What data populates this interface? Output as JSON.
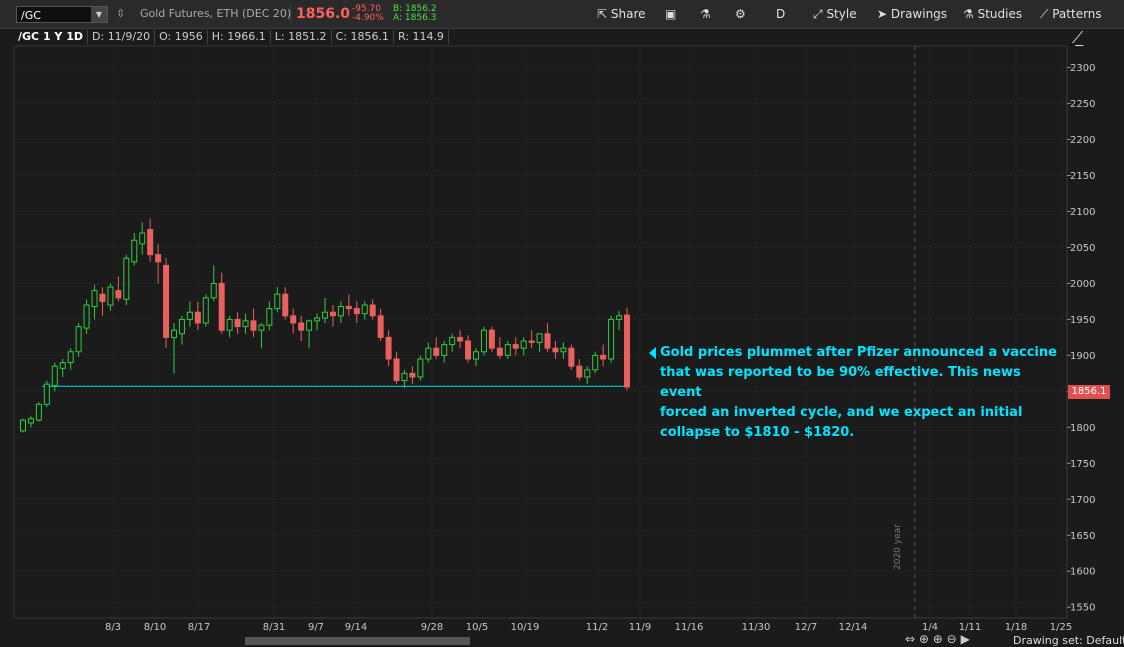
{
  "toolbar": {
    "symbol": "/GC",
    "description": "Gold Futures, ETH (DEC 20)",
    "last_price": "1856.0",
    "change": "-95.70",
    "change_pct": "-4.90%",
    "bid": "B: 1856.2",
    "ask": "A: 1856.3",
    "share_label": "Share",
    "aggregation": "D",
    "style_label": "Style",
    "drawings_label": "Drawings",
    "studies_label": "Studies",
    "patterns_label": "Patterns",
    "colors": {
      "down": "#e05050",
      "up": "#2ecc40",
      "accent": "#00e5ff"
    }
  },
  "infobar": {
    "symbol": "/GC 1 Y 1D",
    "date": "D: 11/9/20",
    "open": "O: 1956",
    "high": "H: 1966.1",
    "low": "L: 1851.2",
    "close": "C: 1856.1",
    "range": "R: 114.9"
  },
  "annotation": {
    "lines": [
      "Gold prices plummet after Pfizer announced a vaccine",
      "that was reported to be 90% effective. This news event",
      "forced an inverted cycle, and we expect an initial",
      "collapse to $1810 - $1820."
    ]
  },
  "price_tag": "1856.1",
  "year_label": "2020 year",
  "drawing_set": "Drawing set: Default",
  "chart_data": {
    "type": "candlestick",
    "y_ticks": [
      1550,
      1600,
      1650,
      1700,
      1750,
      1800,
      1850,
      1900,
      1950,
      2000,
      2050,
      2100,
      2150,
      2200,
      2250,
      2300
    ],
    "ylim": [
      1535,
      2330
    ],
    "x_ticks": [
      "8/3",
      "8/10",
      "8/17",
      "8/31",
      "9/7",
      "9/14",
      "9/28",
      "10/5",
      "10/19",
      "11/2",
      "11/9",
      "11/16",
      "11/30",
      "12/7",
      "12/14",
      "1/4",
      "1/11",
      "1/18",
      "1/25"
    ],
    "support_line": 1857,
    "candles": [
      [
        1795,
        1812,
        1793,
        1810
      ],
      [
        1806,
        1816,
        1800,
        1812
      ],
      [
        1810,
        1835,
        1808,
        1832
      ],
      [
        1832,
        1865,
        1828,
        1860
      ],
      [
        1858,
        1890,
        1850,
        1885
      ],
      [
        1882,
        1895,
        1870,
        1890
      ],
      [
        1890,
        1910,
        1880,
        1905
      ],
      [
        1905,
        1945,
        1898,
        1940
      ],
      [
        1938,
        1978,
        1930,
        1970
      ],
      [
        1968,
        1998,
        1950,
        1990
      ],
      [
        1985,
        1995,
        1955,
        1975
      ],
      [
        1970,
        2000,
        1962,
        1995
      ],
      [
        1990,
        2010,
        1975,
        1980
      ],
      [
        1978,
        2040,
        1970,
        2035
      ],
      [
        2030,
        2070,
        2025,
        2060
      ],
      [
        2055,
        2085,
        2040,
        2070
      ],
      [
        2075,
        2090,
        2030,
        2040
      ],
      [
        2040,
        2055,
        2000,
        2030
      ],
      [
        2025,
        2035,
        1910,
        1925
      ],
      [
        1925,
        1945,
        1875,
        1935
      ],
      [
        1930,
        1955,
        1915,
        1950
      ],
      [
        1950,
        1975,
        1940,
        1960
      ],
      [
        1960,
        1975,
        1935,
        1945
      ],
      [
        1945,
        1985,
        1940,
        1980
      ],
      [
        1980,
        2025,
        1975,
        2000
      ],
      [
        2000,
        2015,
        1930,
        1935
      ],
      [
        1935,
        1955,
        1925,
        1950
      ],
      [
        1950,
        1960,
        1930,
        1940
      ],
      [
        1940,
        1958,
        1930,
        1948
      ],
      [
        1948,
        1965,
        1925,
        1935
      ],
      [
        1935,
        1945,
        1910,
        1942
      ],
      [
        1942,
        1975,
        1935,
        1965
      ],
      [
        1965,
        1995,
        1960,
        1985
      ],
      [
        1985,
        1995,
        1950,
        1955
      ],
      [
        1955,
        1965,
        1930,
        1945
      ],
      [
        1945,
        1955,
        1920,
        1935
      ],
      [
        1935,
        1950,
        1910,
        1948
      ],
      [
        1948,
        1958,
        1935,
        1952
      ],
      [
        1952,
        1980,
        1945,
        1960
      ],
      [
        1960,
        1970,
        1940,
        1955
      ],
      [
        1955,
        1975,
        1945,
        1968
      ],
      [
        1968,
        1985,
        1955,
        1965
      ],
      [
        1965,
        1975,
        1945,
        1958
      ],
      [
        1958,
        1975,
        1950,
        1970
      ],
      [
        1970,
        1978,
        1950,
        1955
      ],
      [
        1955,
        1965,
        1920,
        1925
      ],
      [
        1925,
        1935,
        1885,
        1895
      ],
      [
        1895,
        1905,
        1860,
        1865
      ],
      [
        1865,
        1880,
        1855,
        1875
      ],
      [
        1875,
        1885,
        1860,
        1870
      ],
      [
        1870,
        1900,
        1865,
        1895
      ],
      [
        1895,
        1918,
        1890,
        1910
      ],
      [
        1910,
        1925,
        1895,
        1900
      ],
      [
        1900,
        1920,
        1890,
        1915
      ],
      [
        1915,
        1930,
        1905,
        1925
      ],
      [
        1925,
        1935,
        1910,
        1920
      ],
      [
        1920,
        1928,
        1890,
        1895
      ],
      [
        1895,
        1910,
        1885,
        1905
      ],
      [
        1905,
        1940,
        1900,
        1935
      ],
      [
        1935,
        1940,
        1905,
        1910
      ],
      [
        1910,
        1925,
        1895,
        1900
      ],
      [
        1900,
        1920,
        1895,
        1915
      ],
      [
        1915,
        1925,
        1900,
        1910
      ],
      [
        1910,
        1925,
        1900,
        1920
      ],
      [
        1920,
        1935,
        1910,
        1918
      ],
      [
        1918,
        1930,
        1905,
        1930
      ],
      [
        1930,
        1945,
        1905,
        1910
      ],
      [
        1910,
        1920,
        1895,
        1905
      ],
      [
        1905,
        1918,
        1895,
        1910
      ],
      [
        1910,
        1915,
        1880,
        1885
      ],
      [
        1885,
        1895,
        1865,
        1870
      ],
      [
        1870,
        1885,
        1860,
        1880
      ],
      [
        1880,
        1905,
        1875,
        1900
      ],
      [
        1900,
        1915,
        1885,
        1895
      ],
      [
        1895,
        1955,
        1890,
        1950
      ],
      [
        1950,
        1962,
        1935,
        1955
      ],
      [
        1956,
        1966.1,
        1851.2,
        1856.1
      ]
    ]
  }
}
